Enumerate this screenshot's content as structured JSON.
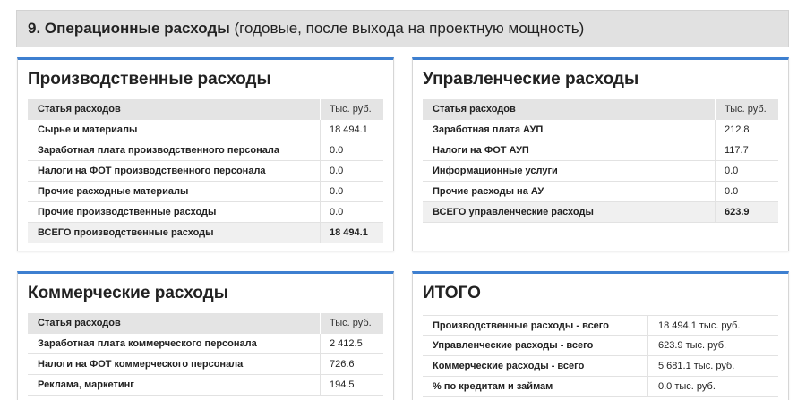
{
  "header": {
    "number_title": "9. Операционные расходы",
    "subtitle": "(годовые, после выхода на проектную мощность)"
  },
  "production": {
    "title": "Производственные расходы",
    "col_item": "Статья расходов",
    "col_value": "Тыс. руб.",
    "rows": [
      {
        "item": "Сырье и материалы",
        "value": "18 494.1"
      },
      {
        "item": "Заработная плата производственного персонала",
        "value": "0.0"
      },
      {
        "item": "Налоги на ФОТ производственного персонала",
        "value": "0.0"
      },
      {
        "item": "Прочие расходные материалы",
        "value": "0.0"
      },
      {
        "item": "Прочие производственные расходы",
        "value": "0.0"
      }
    ],
    "total": {
      "item": "ВСЕГО производственные расходы",
      "value": "18 494.1"
    }
  },
  "management": {
    "title": "Управленческие расходы",
    "col_item": "Статья расходов",
    "col_value": "Тыс. руб.",
    "rows": [
      {
        "item": "Заработная плата АУП",
        "value": "212.8"
      },
      {
        "item": "Налоги на ФОТ АУП",
        "value": "117.7"
      },
      {
        "item": "Информационные услуги",
        "value": "0.0"
      },
      {
        "item": "Прочие расходы на АУ",
        "value": "0.0"
      }
    ],
    "total": {
      "item": "ВСЕГО управленческие расходы",
      "value": "623.9"
    }
  },
  "commercial": {
    "title": "Коммерческие расходы",
    "col_item": "Статья расходов",
    "col_value": "Тыс. руб.",
    "rows": [
      {
        "item": "Заработная плата коммерческого персонала",
        "value": "2 412.5"
      },
      {
        "item": "Налоги на ФОТ коммерческого персонала",
        "value": "726.6"
      },
      {
        "item": "Реклама, маркетинг",
        "value": "194.5"
      }
    ]
  },
  "total": {
    "title": "ИТОГО",
    "rows": [
      {
        "item": "Производственные расходы - всего",
        "value": "18 494.1 тыс. руб."
      },
      {
        "item": "Управленческие расходы - всего",
        "value": "623.9 тыс. руб."
      },
      {
        "item": "Коммерческие расходы - всего",
        "value": "5 681.1 тыс. руб."
      },
      {
        "item": "% по кредитам и займам",
        "value": "0.0 тыс. руб."
      }
    ]
  }
}
